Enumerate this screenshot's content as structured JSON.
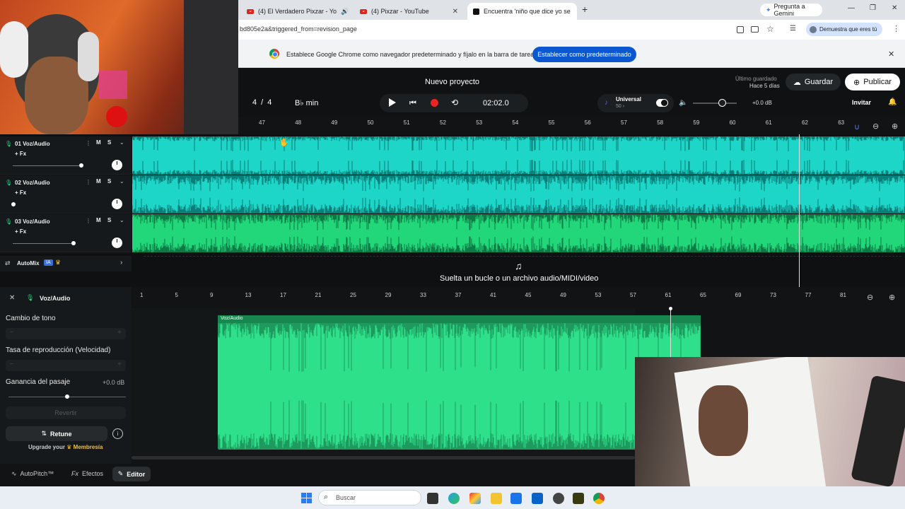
{
  "browser": {
    "tabs": [
      {
        "title": "(4) El Verdadero Pixzar - Yo",
        "icon": "youtube-icon"
      },
      {
        "title": "(4) Pixzar - YouTube",
        "icon": "youtube-icon"
      },
      {
        "title": "Encuentra 'niño que dice yo se",
        "icon": "tiktok-icon"
      }
    ],
    "gemini_label": "Pregunta a Gemini",
    "url": "bd805e2a&triggered_from=revision_page",
    "profile_label": "Demuestra que eres tú",
    "infobar_text": "Establece Google Chrome como navegador predeterminado y fíjalo en la barra de tareas",
    "infobar_button": "Establecer como predeterminado"
  },
  "project": {
    "title": "Nuevo proyecto",
    "last_saved_label": "Último guardado",
    "last_saved_value": "Hace 5 días",
    "save_label": "Guardar",
    "publish_label": "Publicar",
    "time_signature_num": "4",
    "time_signature_sep": "/",
    "time_signature_den": "4",
    "key": "B♭ min",
    "time": "02:02.0",
    "instrument_name": "Universal",
    "instrument_sub": "50 ›",
    "volume_db": "+0.0 dB",
    "invite_label": "Invitar"
  },
  "ruler_top": [
    "47",
    "48",
    "49",
    "50",
    "51",
    "52",
    "53",
    "54",
    "55",
    "56",
    "57",
    "58",
    "59",
    "60",
    "61",
    "62",
    "63"
  ],
  "tracks": [
    {
      "name": "01  Voz/Audio",
      "fx": "+ Fx",
      "mute": "M",
      "solo": "S",
      "color": "#1ed6c8",
      "volume": 0.72
    },
    {
      "name": "02  Voz/Audio",
      "fx": "+ Fx",
      "mute": "M",
      "solo": "S",
      "color": "#1ed6c8",
      "volume": 0.0
    },
    {
      "name": "03  Voz/Audio",
      "fx": "+ Fx",
      "mute": "M",
      "solo": "S",
      "color": "#22d67a",
      "volume": 0.6
    }
  ],
  "automix": {
    "label": "AutoMix",
    "badge": "IA"
  },
  "drop_hint": "Suelta un bucle o un archivo audio/MIDI/video",
  "editor": {
    "track_label": "Voz/Audio",
    "pitch_label": "Cambio de tono",
    "rate_label": "Tasa de reproducción (Velocidad)",
    "gain_label": "Ganancia del pasaje",
    "gain_value": "+0.0 dB",
    "gain_level": 0.5,
    "revert_label": "Revertir",
    "retune_label": "Retune",
    "upgrade_prefix": "Upgrade your",
    "upgrade_link": "Membresía",
    "clip_label": "Voz/Audio"
  },
  "ruler_bottom": [
    "1",
    "5",
    "9",
    "13",
    "17",
    "21",
    "25",
    "29",
    "33",
    "37",
    "41",
    "45",
    "49",
    "53",
    "57",
    "61",
    "65",
    "69",
    "73",
    "77",
    "81"
  ],
  "bottom_tabs": {
    "autopitch": "AutoPitch™",
    "effects": "Efectos",
    "editor": "Editor"
  },
  "taskbar": {
    "search_placeholder": "Buscar"
  }
}
